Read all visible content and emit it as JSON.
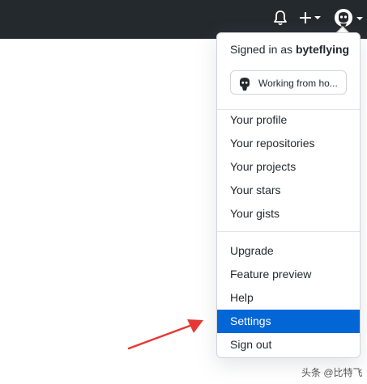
{
  "header": {
    "icons": [
      "bell-icon",
      "plus-icon",
      "avatar"
    ]
  },
  "dropdown": {
    "signed_in_prefix": "Signed in as ",
    "username": "byteflying",
    "status_text": "Working from ho...",
    "group1": [
      "Your profile",
      "Your repositories",
      "Your projects",
      "Your stars",
      "Your gists"
    ],
    "group2": [
      "Upgrade",
      "Feature preview",
      "Help",
      "Settings",
      "Sign out"
    ],
    "active_item": "Settings"
  },
  "colors": {
    "topbar": "#24292e",
    "accent": "#0366d6",
    "arrow": "#e53935"
  },
  "watermark": "头条 @比特飞"
}
